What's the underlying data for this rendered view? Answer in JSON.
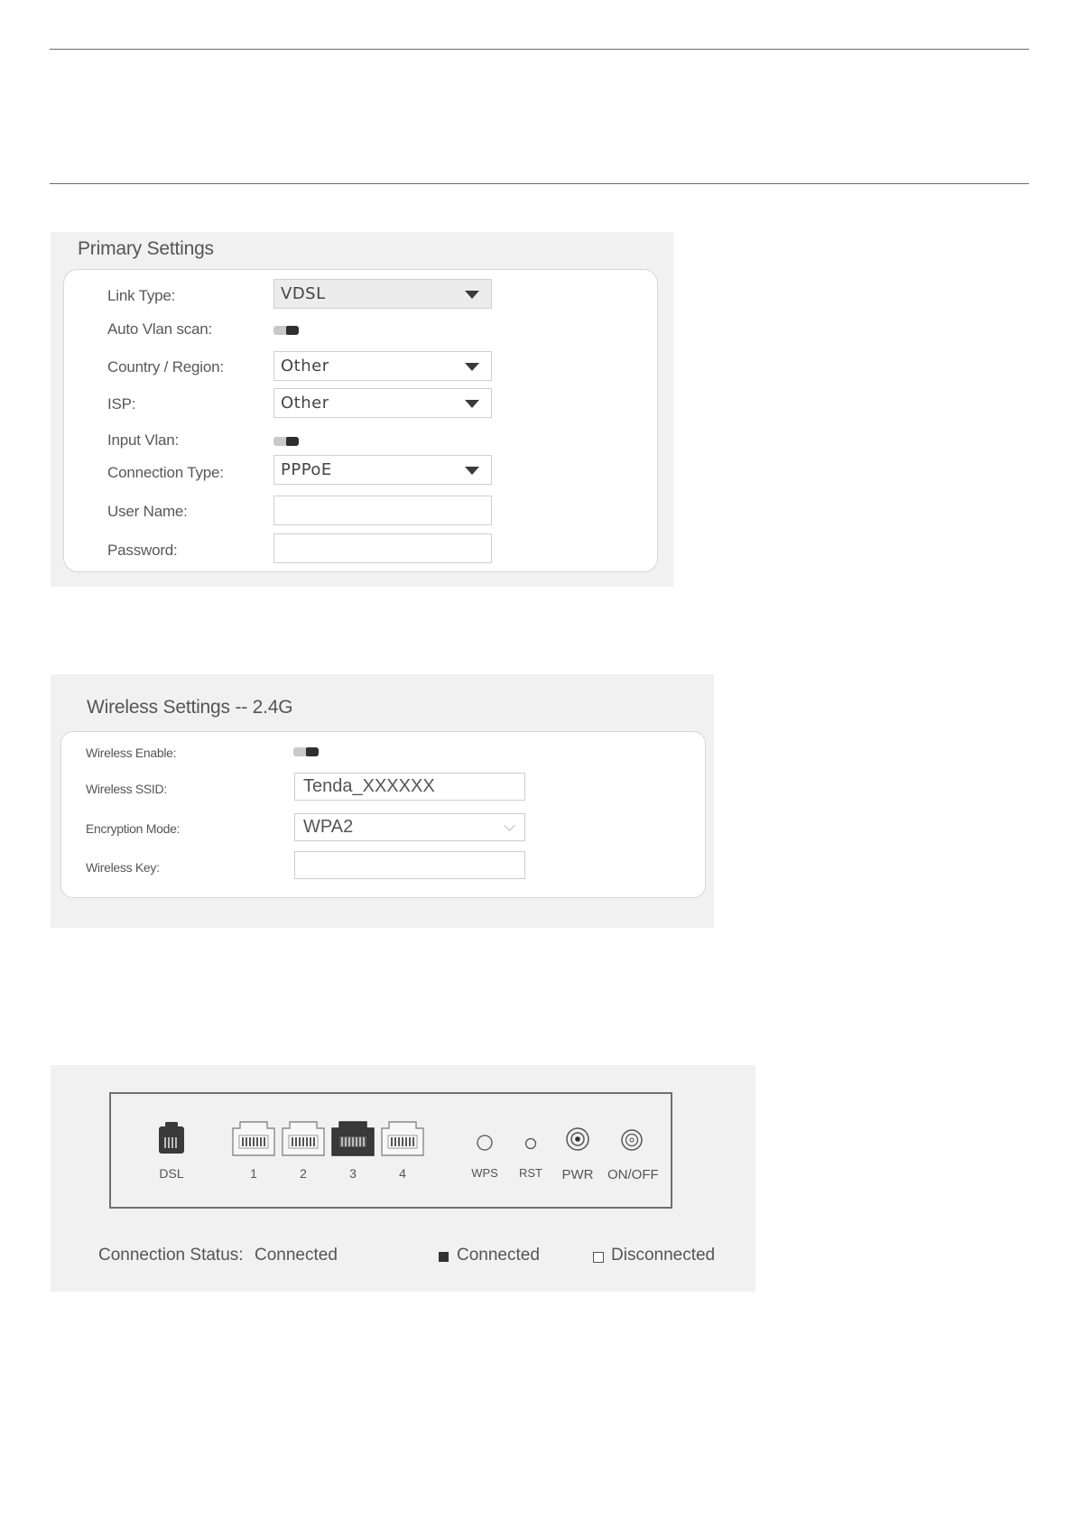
{
  "primary": {
    "title": "Primary Settings",
    "link_type": {
      "label": "Link Type:",
      "value": "VDSL"
    },
    "auto_vlan": {
      "label": "Auto Vlan scan:"
    },
    "country": {
      "label": "Country / Region:",
      "value": "Other"
    },
    "isp": {
      "label": "ISP:",
      "value": "Other"
    },
    "input_vlan": {
      "label": "Input Vlan:"
    },
    "conn_type": {
      "label": "Connection Type:",
      "value": "PPPoE"
    },
    "user_name": {
      "label": "User Name:",
      "value": ""
    },
    "password": {
      "label": "Password:",
      "value": ""
    }
  },
  "wireless": {
    "title": "Wireless Settings -- 2.4G",
    "enable": {
      "label": "Wireless Enable:"
    },
    "ssid": {
      "label": "Wireless SSID:",
      "value": "Tenda_XXXXXX"
    },
    "encryption": {
      "label": "Encryption Mode:",
      "value": "WPA2"
    },
    "key": {
      "label": "Wireless Key:",
      "value": ""
    }
  },
  "ports": {
    "dsl": "DSL",
    "lan": [
      "1",
      "2",
      "3",
      "4"
    ],
    "connected_port": "3",
    "wps": "WPS",
    "rst": "RST",
    "pwr": "PWR",
    "onoff": "ON/OFF"
  },
  "status": {
    "label": "Connection Status:",
    "value": "Connected",
    "legend_connected": "Connected",
    "legend_disconnected": "Disconnected"
  },
  "icons": {
    "dsl": "phone-jack-icon",
    "lan": "ethernet-port-icon",
    "wps": "wps-button-icon",
    "rst": "reset-button-icon",
    "pwr": "power-jack-icon",
    "onoff": "power-switch-icon"
  },
  "colors": {
    "panel": "#f1f1f1",
    "port_active": "#3a3a3a"
  }
}
